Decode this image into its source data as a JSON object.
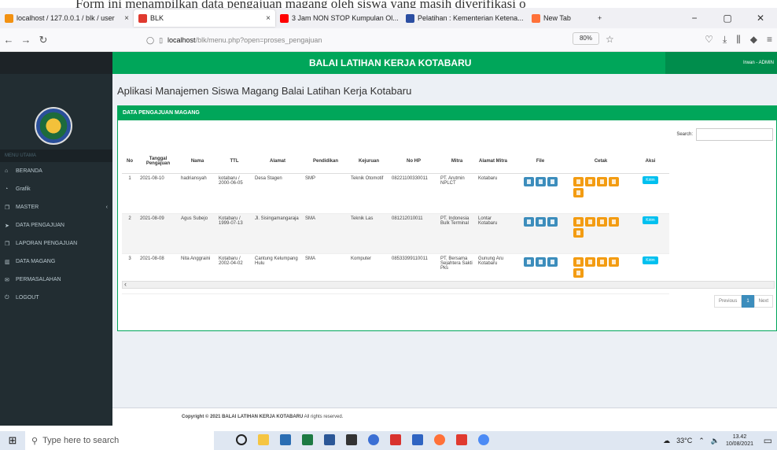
{
  "caption": "Form ini menampilkan data pengajuan magang oleh siswa yang masih diverifikasi o",
  "browser": {
    "tabs": [
      {
        "label": "localhost / 127.0.0.1 / blk / user",
        "icon": "phpmyadmin-icon",
        "color": "#f29111"
      },
      {
        "label": "BLK",
        "icon": "blk-icon",
        "color": "#e03a2f",
        "active": true
      },
      {
        "label": "3 Jam NON STOP Kumpulan Ol...",
        "icon": "youtube-icon",
        "color": "#ff0000"
      },
      {
        "label": "Pelatihan : Kementerian Ketena...",
        "icon": "kemnaker-icon",
        "color": "#2b4ea2"
      },
      {
        "label": "New Tab",
        "icon": "firefox-icon",
        "color": "#ff7139"
      }
    ],
    "url_host": "localhost",
    "url_path": "/blk/menu.php?open=proses_pengajuan",
    "zoom": "80%"
  },
  "app": {
    "title": "BALAI LATIHAN KERJA KOTABARU",
    "user": "Irwan - ADMIN",
    "page_heading": "Aplikasi Manajemen Siswa Magang Balai Latihan Kerja Kotabaru",
    "box_title": "DATA PENGAJUAN MAGANG",
    "search_label": "Search:",
    "sidebar": {
      "header": "MENU UTAMA",
      "items": [
        {
          "label": "BERANDA",
          "icon": "home-icon"
        },
        {
          "label": "Grafik",
          "icon": "pie-chart-icon"
        },
        {
          "label": "MASTER",
          "icon": "folder-icon"
        },
        {
          "label": "DATA PENGAJUAN",
          "icon": "send-icon"
        },
        {
          "label": "LAPORAN PENGAJUAN",
          "icon": "report-icon"
        },
        {
          "label": "DATA MAGANG",
          "icon": "bar-chart-icon"
        },
        {
          "label": "PERMASALAHAN",
          "icon": "comments-icon"
        },
        {
          "label": "LOGOUT",
          "icon": "power-icon"
        }
      ]
    },
    "table": {
      "headers": [
        "No",
        "Tanggal Pengajuan",
        "Nama",
        "TTL",
        "Alamat",
        "Pendidikan",
        "Kejuruan",
        "No HP",
        "Mitra",
        "Alamat Mitra",
        "File",
        "Cetak",
        "Aksi"
      ],
      "rows": [
        {
          "no": "1",
          "tanggal": "2021-08-10",
          "nama": "hadriansyah",
          "ttl": "kotabaru / 2000-06-05",
          "alamat": "Desa Stagen",
          "pendidikan": "SMP",
          "kejuruan": "Teknik Otomotif",
          "hp": "08221100330011",
          "mitra": "PT. Arutmin NPLCT",
          "alamat_mitra": "Kotabaru",
          "aksi": "Kirim"
        },
        {
          "no": "2",
          "tanggal": "2021-08-09",
          "nama": "Agus Subejo",
          "ttl": "Kotabaru / 1999-07-13",
          "alamat": "Jl. Sisingamangaraja",
          "pendidikan": "SMA",
          "kejuruan": "Teknik Las",
          "hp": "081212010011",
          "mitra": "PT. Indonesia Bulk Terminal",
          "alamat_mitra": "Lontar Kotabaru",
          "aksi": "Kirim"
        },
        {
          "no": "3",
          "tanggal": "2021-08-08",
          "nama": "Nita Anggraini",
          "ttl": "Kotabaru / 2002-04-02",
          "alamat": "Cantung Kelumpang Hulu",
          "pendidikan": "SMA",
          "kejuruan": "Komputer",
          "hp": "08533399110011",
          "mitra": "PT. Bersama Sejahtera Sakti Pks",
          "alamat_mitra": "Gunung Aru Kotabaru",
          "aksi": "Kirim"
        }
      ]
    },
    "pager": {
      "previous": "Previous",
      "current": "1",
      "next": "Next"
    },
    "footer_bold": "Copyright © 2021 BALAI LATIHAN KERJA KOTABARU",
    "footer_rest": " All rights reserved."
  },
  "taskbar": {
    "search_placeholder": "Type here to search",
    "weather": "33°C",
    "time": "13.42",
    "date": "10/08/2021"
  }
}
